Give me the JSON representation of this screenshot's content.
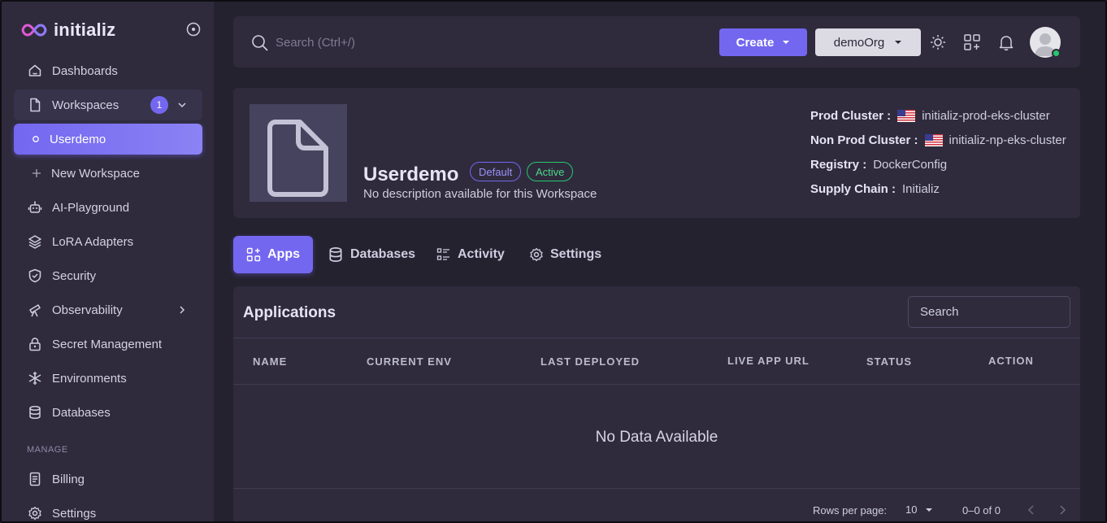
{
  "brand": {
    "name": "initializ"
  },
  "sidebar": {
    "items": [
      {
        "label": "Dashboards"
      },
      {
        "label": "Workspaces",
        "badge": "1"
      },
      {
        "label": "Userdemo"
      },
      {
        "label": "New Workspace"
      },
      {
        "label": "AI-Playground"
      },
      {
        "label": "LoRA Adapters"
      },
      {
        "label": "Security"
      },
      {
        "label": "Observability"
      },
      {
        "label": "Secret Management"
      },
      {
        "label": "Environments"
      },
      {
        "label": "Databases"
      }
    ],
    "section_manage": "MANAGE",
    "manage_items": [
      {
        "label": "Billing"
      },
      {
        "label": "Settings"
      }
    ]
  },
  "header": {
    "search_placeholder": "Search (Ctrl+/)",
    "create_label": "Create",
    "org_label": "demoOrg"
  },
  "workspace": {
    "name": "Userdemo",
    "chip_default": "Default",
    "chip_active": "Active",
    "description": "No description available for this Workspace",
    "info": [
      {
        "key": "Prod Cluster :",
        "value": "initializ-prod-eks-cluster"
      },
      {
        "key": "Non Prod Cluster :",
        "value": "initializ-np-eks-cluster"
      },
      {
        "key": "Registry :",
        "value": "DockerConfig"
      },
      {
        "key": "Supply Chain :",
        "value": "Initializ"
      }
    ]
  },
  "tabs": [
    {
      "label": "Apps"
    },
    {
      "label": "Databases"
    },
    {
      "label": "Activity"
    },
    {
      "label": "Settings"
    }
  ],
  "applications": {
    "title": "Applications",
    "search_placeholder": "Search",
    "columns": [
      "NAME",
      "CURRENT ENV",
      "LAST DEPLOYED",
      "LIVE APP URL",
      "STATUS",
      "ACTION"
    ],
    "empty_text": "No Data Available",
    "footer": {
      "rows_per_page_label": "Rows per page:",
      "rows_per_page_value": "10",
      "range": "0–0 of 0"
    }
  },
  "colors": {
    "accent": "#7367f0",
    "success": "#28c76f",
    "bg": "#25222f",
    "surface": "#2f2b3d"
  }
}
